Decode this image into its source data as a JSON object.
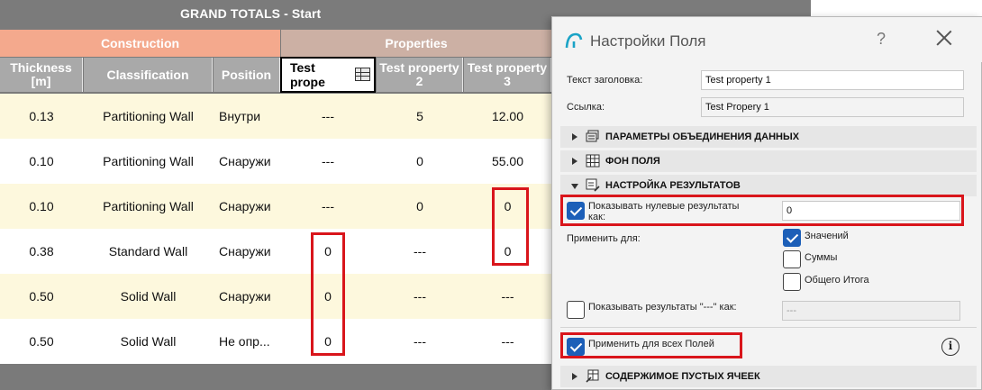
{
  "schedule": {
    "title": "GRAND TOTALS - Start",
    "groups": {
      "construction": "Construction",
      "properties": "Properties"
    },
    "columns": {
      "thickness": "Thickness [m]",
      "classification": "Classification",
      "position": "Position",
      "test1_edit": "Test prope",
      "test2": "Test property 2",
      "test3": "Test property 3"
    },
    "rows": [
      {
        "thickness": "0.13",
        "classification": "Partitioning Wall",
        "position": "Внутри",
        "p1": "---",
        "p2": "5",
        "p3": "12.00"
      },
      {
        "thickness": "0.10",
        "classification": "Partitioning Wall",
        "position": "Снаружи",
        "p1": "---",
        "p2": "0",
        "p3": "55.00"
      },
      {
        "thickness": "0.10",
        "classification": "Partitioning Wall",
        "position": "Снаружи",
        "p1": "---",
        "p2": "0",
        "p3": "0"
      },
      {
        "thickness": "0.38",
        "classification": "Standard Wall",
        "position": "Снаружи",
        "p1": "0",
        "p2": "---",
        "p3": "0"
      },
      {
        "thickness": "0.50",
        "classification": "Solid Wall",
        "position": "Снаружи",
        "p1": "0",
        "p2": "---",
        "p3": "---"
      },
      {
        "thickness": "0.50",
        "classification": "Solid Wall",
        "position": "Не опр...",
        "p1": "0",
        "p2": "---",
        "p3": "---"
      }
    ]
  },
  "dialog": {
    "title": "Настройки Поля",
    "help": "?",
    "header_text_label": "Текст заголовка:",
    "header_text_value": "Test property 1",
    "link_label": "Ссылка:",
    "link_value": "Test Propery 1",
    "sections": {
      "merge": "ПАРАМЕТРЫ ОБЪЕДИНЕНИЯ ДАННЫХ",
      "background": "ФОН ПОЛЯ",
      "results": "НАСТРОЙКА РЕЗУЛЬТАТОВ",
      "empty": "СОДЕРЖИМОЕ ПУСТЫХ ЯЧЕЕК"
    },
    "show_zero_label": "Показывать нулевые результаты как:",
    "show_zero_value": "0",
    "apply_for_label": "Применить для:",
    "apply_values": "Значений",
    "apply_sums": "Суммы",
    "apply_total": "Общего Итога",
    "show_dash_label": "Показывать результаты \"---\" как:",
    "show_dash_value": "---",
    "apply_all_label": "Применить для всех Полей",
    "info": "i"
  },
  "colors": {
    "title_bg": "#7b7b7b",
    "construction_bg": "#f4a98d",
    "properties_bg": "#ccb0a4",
    "header_bg": "#a9a9a9",
    "row_odd": "#fdf8dd",
    "row_even": "#ffffff",
    "highlight": "#d9151b",
    "checkbox_blue": "#1c5fb8"
  }
}
